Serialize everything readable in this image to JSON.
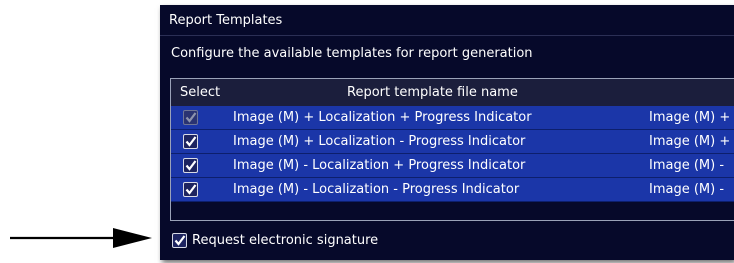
{
  "panel": {
    "title": "Report Templates",
    "subtitle": "Configure the available templates for report generation"
  },
  "table": {
    "columns": [
      "Select",
      "Report template file name"
    ],
    "rows": [
      {
        "checked": true,
        "disabled": true,
        "name": "Image (M) + Localization + Progress Indicator",
        "extra": "Image (M) +"
      },
      {
        "checked": true,
        "disabled": false,
        "name": "Image (M) + Localization - Progress Indicator",
        "extra": "Image (M) +"
      },
      {
        "checked": true,
        "disabled": false,
        "name": "Image (M) - Localization + Progress Indicator",
        "extra": "Image (M) -"
      },
      {
        "checked": true,
        "disabled": false,
        "name": "Image (M) - Localization - Progress Indicator",
        "extra": "Image (M) -"
      }
    ]
  },
  "signature": {
    "checked": true,
    "label": "Request electronic signature"
  },
  "colors": {
    "panel_bg": "#06092a",
    "row_selected": "#1b36a8",
    "header_bg": "#1b1e3c",
    "arrow": "#000000"
  }
}
